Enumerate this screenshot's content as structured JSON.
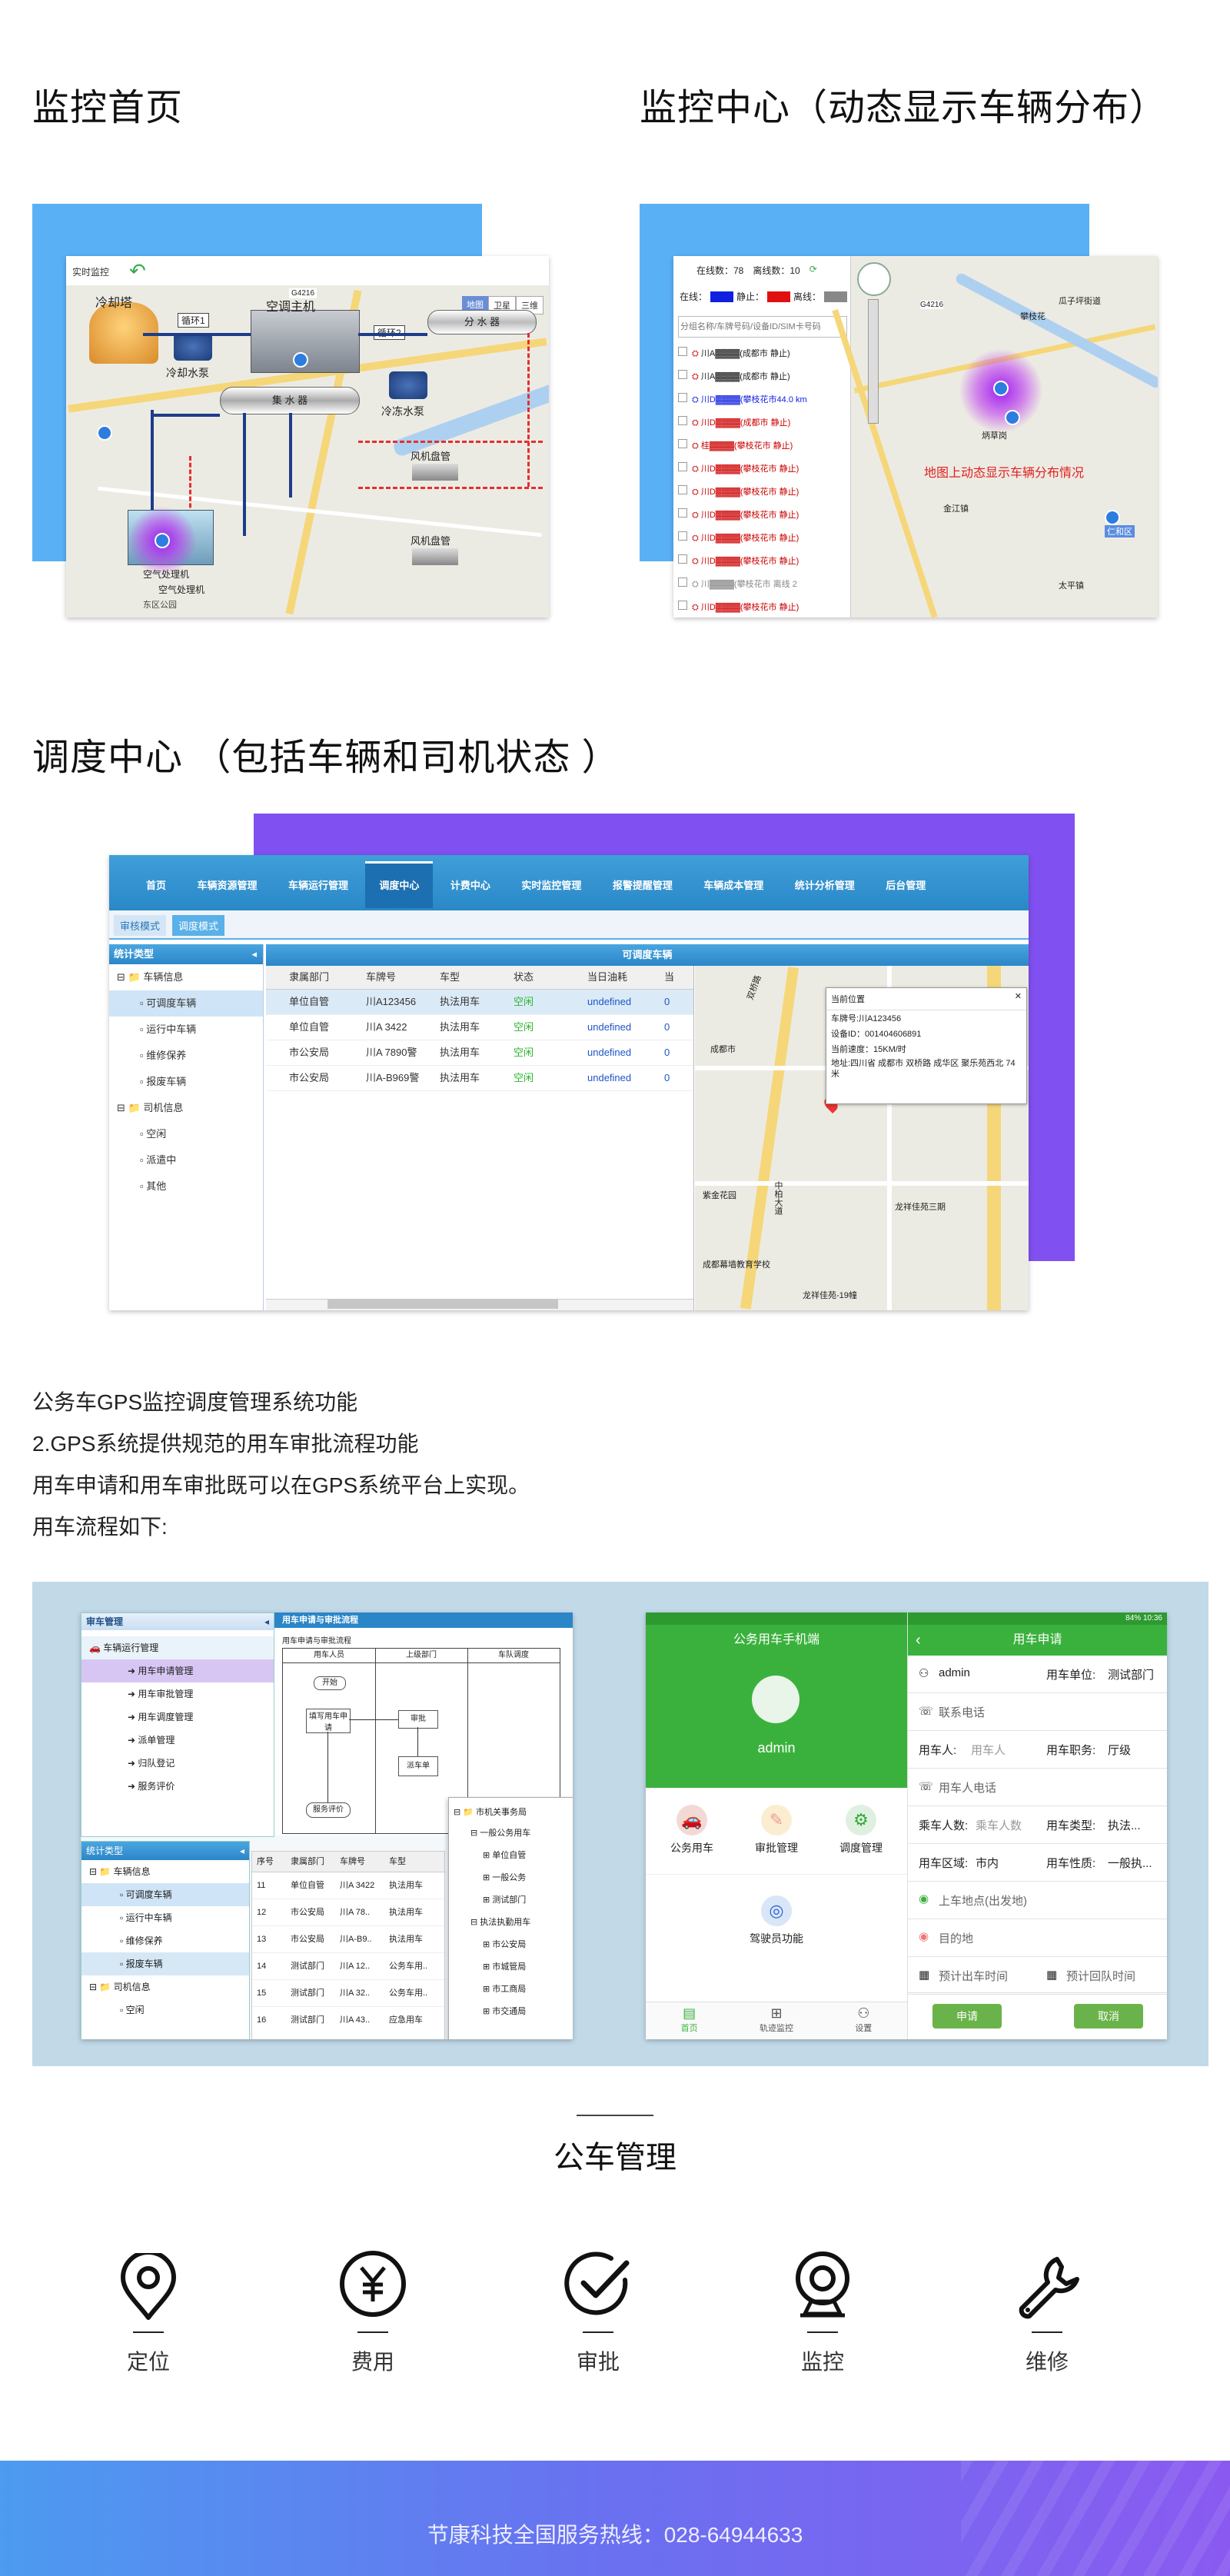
{
  "sections": {
    "monitor_home": {
      "title": "监控首页"
    },
    "monitor_center": {
      "title": "监控中心（动态显示车辆分布）"
    },
    "dispatch_center": {
      "title": "调度中心 （包括车辆和司机状态 ）"
    }
  },
  "shot1": {
    "tab_label": "实时监控",
    "map_types": [
      "地图",
      "卫星",
      "三维"
    ],
    "labels": {
      "cooling_tower": "冷却塔",
      "hvac_host": "空调主机",
      "loop1": "循环1",
      "loop2": "循环2",
      "divider": "分 水 器",
      "collector": "集 水 器",
      "cooling_pump": "冷却水泵",
      "chilled_pump": "冷冻水泵",
      "fan_coil_1": "风机盘管",
      "fan_coil_2": "风机盘管",
      "air_handler": "空气处理机",
      "ahu_2": "空气处理机",
      "road_tag": "G4216",
      "park": "东区公园"
    }
  },
  "shot2": {
    "online": "在线数：78",
    "offline": "离线数：10",
    "legend": {
      "moving": "在线：",
      "stopped": "静止：",
      "offline_label": "离线："
    },
    "search_placeholder": "分组名称/车牌号码/设备ID/SIM卡号码",
    "vehicles": [
      "川A▓▓▓▓(成都市 静止)",
      "川A▓▓▓▓(成都市 静止)",
      "川D▓▓▓▓(攀枝花市44.0 km",
      "川D▓▓▓▓(成都市 静止)",
      "桂▓▓▓▓(攀枝花市 静止)",
      "川D▓▓▓▓(攀枝花市 静止)",
      "川D▓▓▓▓(攀枝花市 静止)",
      "川D▓▓▓▓(攀枝花市 静止)",
      "川D▓▓▓▓(攀枝花市 静止)",
      "川D▓▓▓▓(攀枝花市 静止)",
      "川▓▓▓▓(攀枝花市 离线 2",
      "川D▓▓▓▓(攀枝花市 静止)"
    ],
    "caption": "地图上动态显示车辆分布情况",
    "map_labels": [
      "攀枝花",
      "瓜子坪街道",
      "炳草岗",
      "仁和区",
      "G4216",
      "金江镇",
      "太平镇"
    ]
  },
  "shot3": {
    "nav": [
      "首页",
      "车辆资源管理",
      "车辆运行管理",
      "调度中心",
      "计费中心",
      "实时监控管理",
      "报警提醒管理",
      "车辆成本管理",
      "统计分析管理",
      "后台管理"
    ],
    "active_nav": "调度中心",
    "subtabs": [
      "审核模式",
      "调度模式"
    ],
    "left_header": "统计类型",
    "tree": [
      "车辆信息",
      "可调度车辆",
      "运行中车辆",
      "维修保养",
      "报废车辆",
      "司机信息",
      "空闲",
      "派遣中",
      "其他"
    ],
    "grid_title": "可调度车辆",
    "columns": [
      "隶属部门",
      "车牌号",
      "车型",
      "状态",
      "当日油耗",
      "当"
    ],
    "rows": [
      [
        "单位自管",
        "川A123456",
        "执法用车",
        "空闲",
        "undefined",
        "0"
      ],
      [
        "单位自管",
        "川A 3422",
        "执法用车",
        "空闲",
        "undefined",
        "0"
      ],
      [
        "市公安局",
        "川A 7890警",
        "执法用车",
        "空闲",
        "undefined",
        "0"
      ],
      [
        "市公安局",
        "川A-B969警",
        "执法用车",
        "空闲",
        "undefined",
        "0"
      ]
    ],
    "popup": {
      "title": "当前位置",
      "plate": "车牌号:川A123456",
      "device": "设备ID：001404606891",
      "speed": "当前速度：15KM/时",
      "address": "地址:四川省 成都市 双桥路 成华区 聚乐苑西北 74米"
    },
    "map_labels": [
      "双桥路",
      "成都市",
      "中柏大道",
      "龙祥佳苑三期",
      "龙祥佳苑-19幢",
      "成都幕墙教育学校",
      "紫金花园"
    ]
  },
  "body_text": [
    "公务车GPS监控调度管理系统功能",
    "2.GPS系统提供规范的用车审批流程功能",
    "用车申请和用车审批既可以在GPS系统平台上实现。",
    "用车流程如下:"
  ],
  "shot4": {
    "panel_title": "审车管理",
    "tree_root": "车辆运行管理",
    "tree_items": [
      "用车申请管理",
      "用车审批管理",
      "用车调度管理",
      "派单管理",
      "归队登记",
      "服务评价"
    ],
    "flow_title": "用车申请与审批流程",
    "flow_sub": "用车申请与审批流程",
    "flow_cols": [
      "用车人员",
      "上级部门",
      "车队调度"
    ],
    "flow_nodes": [
      "开始",
      "填写用车申请",
      "审批",
      "派车单",
      "服务评价"
    ],
    "stat_header": "统计类型",
    "stat_tree": [
      "车辆信息",
      "可调度车辆",
      "运行中车辆",
      "维修保养",
      "报废车辆",
      "司机信息",
      "空闲"
    ],
    "grid_cols": [
      "序号",
      "隶属部门",
      "车牌号",
      "车型"
    ],
    "grid_rows": [
      [
        "11",
        "单位自管",
        "川A 3422",
        "执法用车"
      ],
      [
        "12",
        "市公安局",
        "川A 78..",
        "执法用车"
      ],
      [
        "13",
        "市公安局",
        "川A-B9..",
        "执法用车"
      ],
      [
        "14",
        "测试部门",
        "川A 12..",
        "公务车用.."
      ],
      [
        "15",
        "测试部门",
        "川A 32..",
        "公务车用.."
      ],
      [
        "16",
        "测试部门",
        "川A 43..",
        "应急用车"
      ]
    ],
    "org_root": "市机关事务局",
    "org_items": [
      "一般公务用车",
      "单位自管",
      "一般公务",
      "测试部门",
      "执法执勤用车",
      "市公安局",
      "市城管局",
      "市工商局",
      "市交通局"
    ]
  },
  "shot5": {
    "left_title": "公务用车手机端",
    "user": "admin",
    "menu": [
      "公务用车",
      "审批管理",
      "调度管理",
      "驾驶员功能"
    ],
    "tabbar": [
      "首页",
      "轨迹监控",
      "设置"
    ],
    "right_title": "用车申请",
    "status_time": "10:36",
    "status_battery": "84%",
    "form": {
      "user": "admin",
      "unit_label": "用车单位:",
      "unit": "测试部门",
      "phone": "联系电话",
      "person_label": "用车人:",
      "person_ph": "用车人",
      "post_label": "用车职务:",
      "post": "厅级",
      "person_phone": "用车人电话",
      "count_label": "乘车人数:",
      "count_ph": "乘车人数",
      "type_label": "用车类型:",
      "type": "执法...",
      "area_label": "用车区域:",
      "area": "市内",
      "nature_label": "用车性质:",
      "nature": "一般执...",
      "pickup": "上车地点(出发地)",
      "dest": "目的地",
      "out_time": "预计出车时间",
      "back_time": "预计回队时间",
      "apply": "申请",
      "cancel": "取消"
    }
  },
  "features": {
    "title": "公车管理",
    "items": [
      {
        "label": "定位",
        "icon": "location-pin-icon"
      },
      {
        "label": "费用",
        "icon": "yen-coin-icon"
      },
      {
        "label": "审批",
        "icon": "check-circle-icon"
      },
      {
        "label": "监控",
        "icon": "webcam-icon"
      },
      {
        "label": "维修",
        "icon": "wrench-icon"
      }
    ]
  },
  "footer": {
    "hotline": "节康科技全国服务热线：028-64944633"
  },
  "colors": {
    "accent_blue": "#5ab0f5",
    "accent_purple": "#8050f0",
    "mobile_green": "#3bb13d",
    "nav_blue": "#2a88c8"
  }
}
